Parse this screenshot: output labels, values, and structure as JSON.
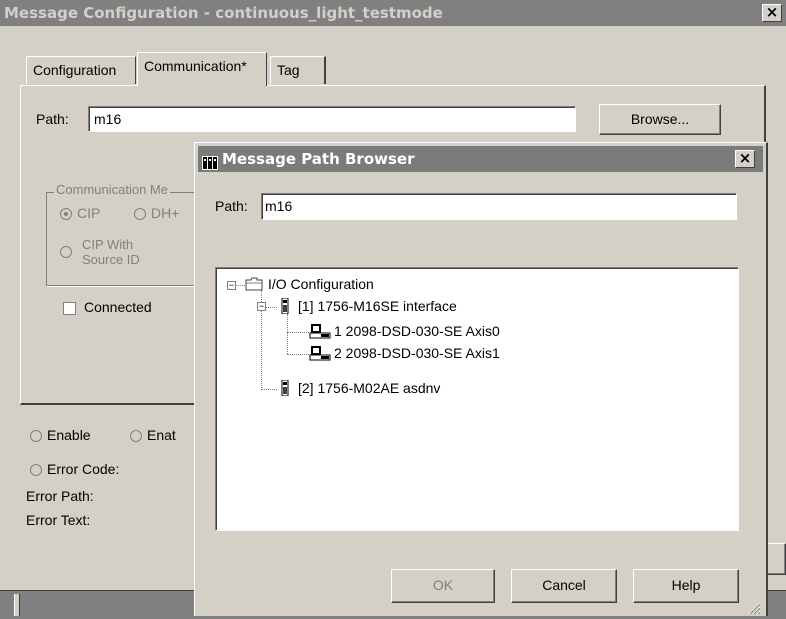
{
  "main_window": {
    "title": "Message Configuration - continuous_light_testmode",
    "close": "×",
    "tabs": [
      {
        "label": "Configuration"
      },
      {
        "label": "Communication*"
      },
      {
        "label": "Tag"
      }
    ],
    "path_label": "Path:",
    "path_value": "m16",
    "browse_label": "Browse...",
    "comm_method_label": "Communication Me",
    "cip_label": "CIP",
    "dh_label": "DH+",
    "cip_source_label1": "CIP With",
    "cip_source_label2": "Source ID",
    "connected_label": "Connected",
    "enable_label": "Enable",
    "enable_waiting_label": "Enat",
    "error_code_label": "Error Code:",
    "error_path_label": "Error Path:",
    "error_text_label": "Error Text:"
  },
  "browser_dialog": {
    "title": "Message Path Browser",
    "close": "×",
    "path_label": "Path:",
    "path_value": "m16",
    "tree": {
      "root": "I/O Configuration",
      "node1": "[1] 1756-M16SE interface",
      "child1": "1 2098-DSD-030-SE Axis0",
      "child2": "2 2098-DSD-030-SE Axis1",
      "node2": "[2] 1756-M02AE asdnv",
      "collapse_glyph": "−"
    },
    "ok_label": "OK",
    "cancel_label": "Cancel",
    "help_label": "Help"
  }
}
